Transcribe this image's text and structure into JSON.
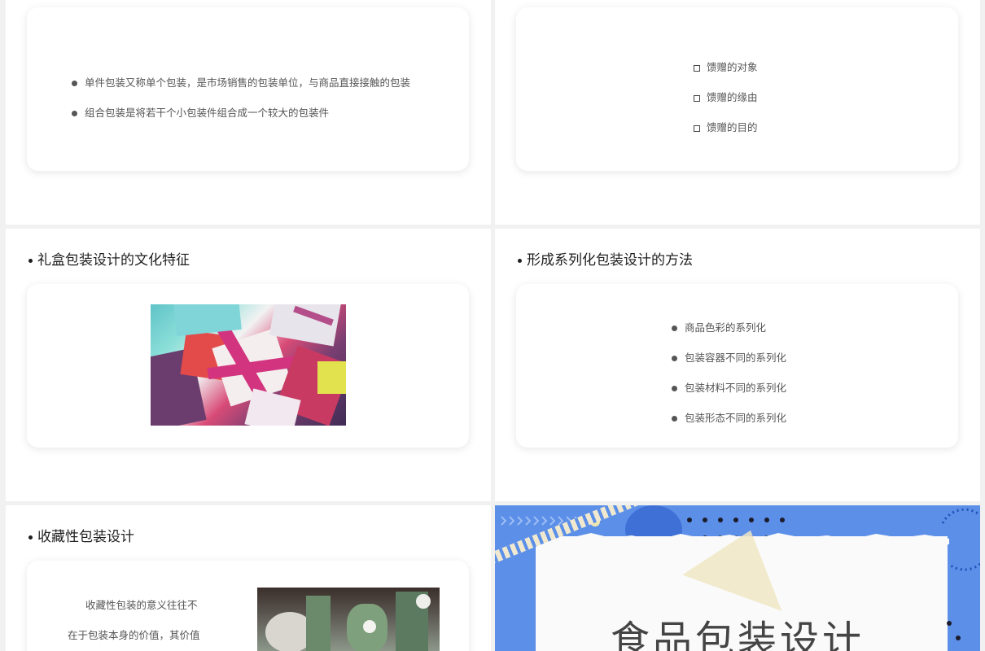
{
  "slides": {
    "s1": {
      "bullets": [
        "单件包装又称单个包装，是市场销售的包装单位，与商品直接接触的包装",
        "组合包装是将若干个小包装件组合成一个较大的包装件"
      ]
    },
    "s2": {
      "bullets": [
        "馈赠的对象",
        "馈赠的缘由",
        "馈赠的目的"
      ]
    },
    "s3": {
      "heading": "礼盒包装设计的文化特征"
    },
    "s4": {
      "heading": "形成系列化包装设计的方法",
      "bullets": [
        "商品色彩的系列化",
        "包装容器不同的系列化",
        "包装材料不同的系列化",
        "包装形态不同的系列化"
      ]
    },
    "s5": {
      "heading": "收藏性包装设计",
      "paragraph_lines": [
        "收藏性包装的意义往往不",
        "在于包装本身的价值，其价值"
      ]
    },
    "s6": {
      "title": "食品包装设计"
    }
  },
  "colors": {
    "title_slide_blue": "#5b8fe8",
    "accent_yellow": "#f0e6b0"
  }
}
